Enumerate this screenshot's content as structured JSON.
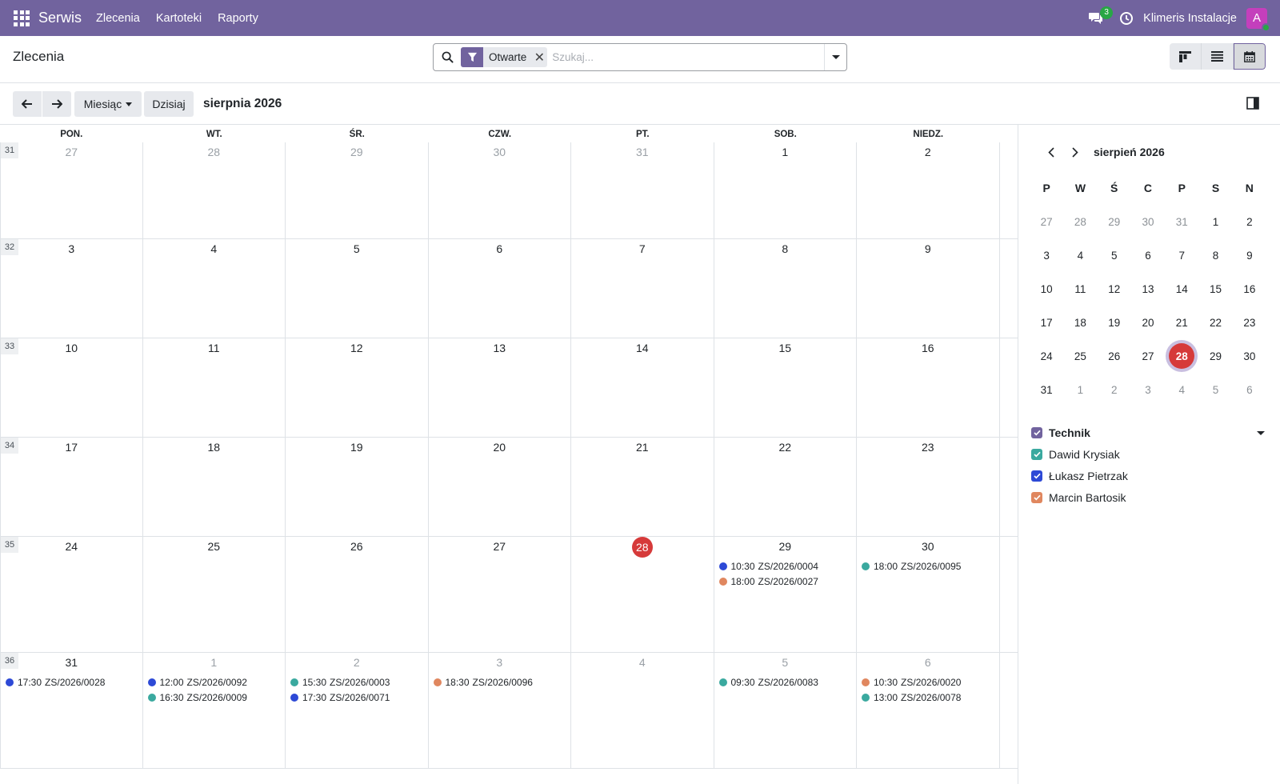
{
  "navbar": {
    "brand": "Serwis",
    "menus": [
      "Zlecenia",
      "Kartoteki",
      "Raporty"
    ],
    "chat_count": "3",
    "company": "Klimeris Instalacje",
    "avatar_letter": "A"
  },
  "control": {
    "title": "Zlecenia",
    "facet": "Otwarte",
    "search_placeholder": "Szukaj..."
  },
  "toolbar": {
    "scale_label": "Miesiąc",
    "today_label": "Dzisiaj",
    "range": "sierpnia 2026"
  },
  "calendar": {
    "day_headers": [
      "PON.",
      "WT.",
      "ŚR.",
      "CZW.",
      "PT.",
      "SOB.",
      "NIEDZ."
    ],
    "today": "28",
    "weeks": [
      {
        "week": "31",
        "days": [
          {
            "n": "27",
            "other": true
          },
          {
            "n": "28",
            "other": true
          },
          {
            "n": "29",
            "other": true
          },
          {
            "n": "30",
            "other": true
          },
          {
            "n": "31",
            "other": true
          },
          {
            "n": "1"
          },
          {
            "n": "2"
          }
        ]
      },
      {
        "week": "32",
        "days": [
          {
            "n": "3"
          },
          {
            "n": "4"
          },
          {
            "n": "5"
          },
          {
            "n": "6"
          },
          {
            "n": "7"
          },
          {
            "n": "8"
          },
          {
            "n": "9"
          }
        ]
      },
      {
        "week": "33",
        "days": [
          {
            "n": "10"
          },
          {
            "n": "11"
          },
          {
            "n": "12"
          },
          {
            "n": "13"
          },
          {
            "n": "14"
          },
          {
            "n": "15"
          },
          {
            "n": "16"
          }
        ]
      },
      {
        "week": "34",
        "days": [
          {
            "n": "17"
          },
          {
            "n": "18"
          },
          {
            "n": "19"
          },
          {
            "n": "20"
          },
          {
            "n": "21"
          },
          {
            "n": "22"
          },
          {
            "n": "23"
          }
        ]
      },
      {
        "week": "35",
        "days": [
          {
            "n": "24"
          },
          {
            "n": "25"
          },
          {
            "n": "26"
          },
          {
            "n": "27"
          },
          {
            "n": "28",
            "today": true
          },
          {
            "n": "29",
            "events": [
              {
                "time": "10:30",
                "ref": "ZS/2026/0004",
                "tech": "lukasz"
              },
              {
                "time": "18:00",
                "ref": "ZS/2026/0027",
                "tech": "marcin"
              }
            ]
          },
          {
            "n": "30",
            "events": [
              {
                "time": "18:00",
                "ref": "ZS/2026/0095",
                "tech": "dawid"
              }
            ]
          }
        ]
      },
      {
        "week": "36",
        "days": [
          {
            "n": "31",
            "events": [
              {
                "time": "17:30",
                "ref": "ZS/2026/0028",
                "tech": "lukasz"
              }
            ]
          },
          {
            "n": "1",
            "other": true,
            "events": [
              {
                "time": "12:00",
                "ref": "ZS/2026/0092",
                "tech": "lukasz"
              },
              {
                "time": "16:30",
                "ref": "ZS/2026/0009",
                "tech": "dawid"
              }
            ]
          },
          {
            "n": "2",
            "other": true,
            "events": [
              {
                "time": "15:30",
                "ref": "ZS/2026/0003",
                "tech": "dawid"
              },
              {
                "time": "17:30",
                "ref": "ZS/2026/0071",
                "tech": "lukasz"
              }
            ]
          },
          {
            "n": "3",
            "other": true,
            "events": [
              {
                "time": "18:30",
                "ref": "ZS/2026/0096",
                "tech": "marcin"
              }
            ]
          },
          {
            "n": "4",
            "other": true
          },
          {
            "n": "5",
            "other": true,
            "events": [
              {
                "time": "09:30",
                "ref": "ZS/2026/0083",
                "tech": "dawid"
              }
            ]
          },
          {
            "n": "6",
            "other": true,
            "events": [
              {
                "time": "10:30",
                "ref": "ZS/2026/0020",
                "tech": "marcin"
              },
              {
                "time": "13:00",
                "ref": "ZS/2026/0078",
                "tech": "dawid"
              }
            ]
          }
        ]
      }
    ]
  },
  "mini_calendar": {
    "title": "sierpień 2026",
    "dow": [
      "P",
      "W",
      "Ś",
      "C",
      "P",
      "S",
      "N"
    ],
    "rows": [
      [
        {
          "n": "27",
          "o": true
        },
        {
          "n": "28",
          "o": true
        },
        {
          "n": "29",
          "o": true
        },
        {
          "n": "30",
          "o": true
        },
        {
          "n": "31",
          "o": true
        },
        {
          "n": "1"
        },
        {
          "n": "2"
        }
      ],
      [
        {
          "n": "3"
        },
        {
          "n": "4"
        },
        {
          "n": "5"
        },
        {
          "n": "6"
        },
        {
          "n": "7"
        },
        {
          "n": "8"
        },
        {
          "n": "9"
        }
      ],
      [
        {
          "n": "10"
        },
        {
          "n": "11"
        },
        {
          "n": "12"
        },
        {
          "n": "13"
        },
        {
          "n": "14"
        },
        {
          "n": "15"
        },
        {
          "n": "16"
        }
      ],
      [
        {
          "n": "17"
        },
        {
          "n": "18"
        },
        {
          "n": "19"
        },
        {
          "n": "20"
        },
        {
          "n": "21"
        },
        {
          "n": "22"
        },
        {
          "n": "23"
        }
      ],
      [
        {
          "n": "24"
        },
        {
          "n": "25"
        },
        {
          "n": "26"
        },
        {
          "n": "27"
        },
        {
          "n": "28",
          "t": true
        },
        {
          "n": "29"
        },
        {
          "n": "30"
        }
      ],
      [
        {
          "n": "31"
        },
        {
          "n": "1",
          "o": true
        },
        {
          "n": "2",
          "o": true
        },
        {
          "n": "3",
          "o": true
        },
        {
          "n": "4",
          "o": true
        },
        {
          "n": "5",
          "o": true
        },
        {
          "n": "6",
          "o": true
        }
      ]
    ]
  },
  "filters": {
    "group_label": "Technik",
    "group_color": "#71639e",
    "items": [
      {
        "key": "dawid",
        "label": "Dawid Krysiak",
        "color": "#3aa99f"
      },
      {
        "key": "lukasz",
        "label": "Łukasz Pietrzak",
        "color": "#2d49d6"
      },
      {
        "key": "marcin",
        "label": "Marcin Bartosik",
        "color": "#e0875f"
      }
    ]
  },
  "colors": {
    "navbar": "#71639e",
    "today": "#d63a3a"
  }
}
